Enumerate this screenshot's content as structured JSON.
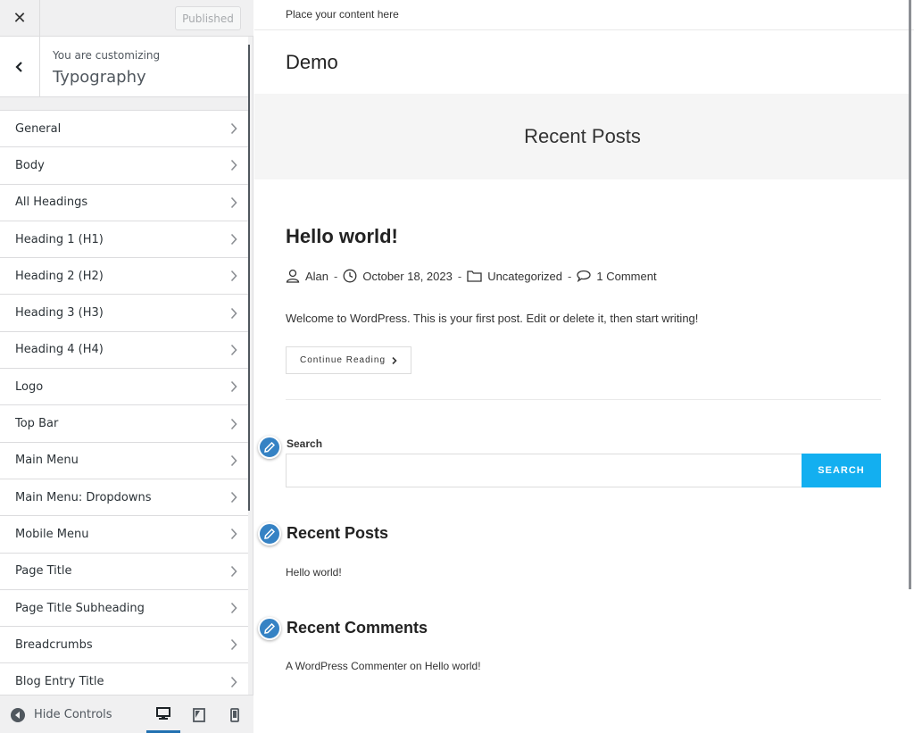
{
  "customizer": {
    "close_label": "✕",
    "publish_label": "Published",
    "customizing_label": "You are customizing",
    "section_title": "Typography",
    "menu": [
      {
        "label": "General",
        "name": "general"
      },
      {
        "label": "Body",
        "name": "body"
      },
      {
        "label": "All Headings",
        "name": "all-headings"
      },
      {
        "label": "Heading 1 (H1)",
        "name": "heading-1"
      },
      {
        "label": "Heading 2 (H2)",
        "name": "heading-2"
      },
      {
        "label": "Heading 3 (H3)",
        "name": "heading-3"
      },
      {
        "label": "Heading 4 (H4)",
        "name": "heading-4"
      },
      {
        "label": "Logo",
        "name": "logo"
      },
      {
        "label": "Top Bar",
        "name": "top-bar"
      },
      {
        "label": "Main Menu",
        "name": "main-menu"
      },
      {
        "label": "Main Menu: Dropdowns",
        "name": "main-menu-dropdowns"
      },
      {
        "label": "Mobile Menu",
        "name": "mobile-menu"
      },
      {
        "label": "Page Title",
        "name": "page-title"
      },
      {
        "label": "Page Title Subheading",
        "name": "page-title-subheading"
      },
      {
        "label": "Breadcrumbs",
        "name": "breadcrumbs"
      },
      {
        "label": "Blog Entry Title",
        "name": "blog-entry-title"
      }
    ],
    "footer": {
      "hide_controls_label": "Hide Controls",
      "devices": [
        "desktop-icon",
        "tablet-icon",
        "mobile-icon"
      ],
      "active_device": "desktop"
    }
  },
  "preview": {
    "topbar_text": "Place your content here",
    "site_title": "Demo",
    "page_title": "Recent Posts",
    "post": {
      "title": "Hello world!",
      "author": "Alan",
      "date": "October 18, 2023",
      "category": "Uncategorized",
      "comments": "1 Comment",
      "separator": "-",
      "excerpt": "Welcome to WordPress. This is your first post. Edit or delete it, then start writing!",
      "continue_label": "Continue Reading"
    },
    "search_widget": {
      "label": "Search",
      "input_value": "",
      "button_label": "SEARCH"
    },
    "recent_posts_widget": {
      "title": "Recent Posts",
      "items": [
        "Hello world!"
      ]
    },
    "recent_comments_widget": {
      "title": "Recent Comments",
      "commenter": "A WordPress Commenter",
      "connector": "on",
      "post_link": "Hello world!"
    }
  },
  "colors": {
    "accent": "#13aff0",
    "edit_shortcut": "#3582c4",
    "active_device": "#2271b1"
  }
}
